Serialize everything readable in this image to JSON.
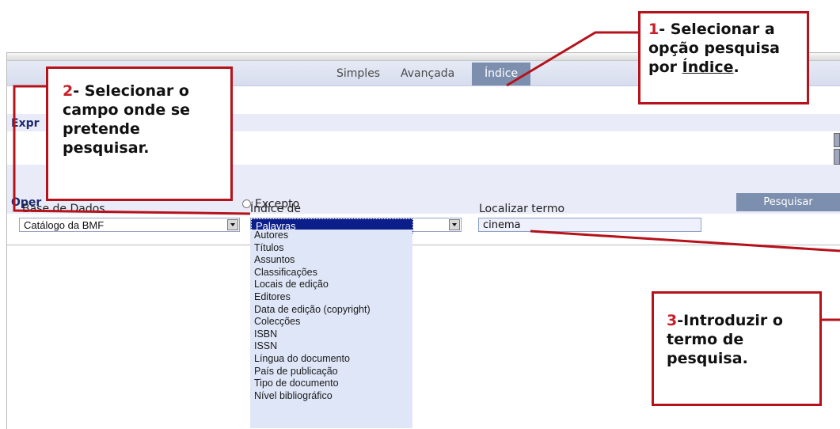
{
  "tabs": [
    {
      "label": "Simples"
    },
    {
      "label": "Avançada"
    },
    {
      "label": "Índice"
    }
  ],
  "bands": {
    "expr_label": "Expr",
    "oper_label": "Oper"
  },
  "excepto_label": "Excepto",
  "search_button": "Pesquisar",
  "fields": {
    "database_label": "Base de Dados",
    "database_value": "Catálogo da BMF",
    "index_label": "Índice de",
    "index_value": "Palavras",
    "term_label": "Localizar termo",
    "term_value": "cinema"
  },
  "index_options": [
    "Palavras",
    "Autores",
    "Títulos",
    "Assuntos",
    "Classificações",
    "Locais de edição",
    "Editores",
    "Data de edição (copyright)",
    "Colecções",
    "ISBN",
    "ISSN",
    "Língua do documento",
    "País de publicação",
    "Tipo de documento",
    "Nível bibliográfico"
  ],
  "callouts": {
    "c1_num": "1",
    "c1_text_a": "- Selecionar a opção pesquisa por ",
    "c1_text_b": "Índice",
    "c1_text_c": ".",
    "c2_num": "2",
    "c2_text": "- Selecionar o campo onde se pretende pesquisar.",
    "c3_num": "3",
    "c3_text": "-Introduzir o termo de pesquisa."
  },
  "colors": {
    "callout_border": "#b5121b",
    "active_tab": "#7d8fae",
    "selected_option": "#0b1e8a"
  }
}
